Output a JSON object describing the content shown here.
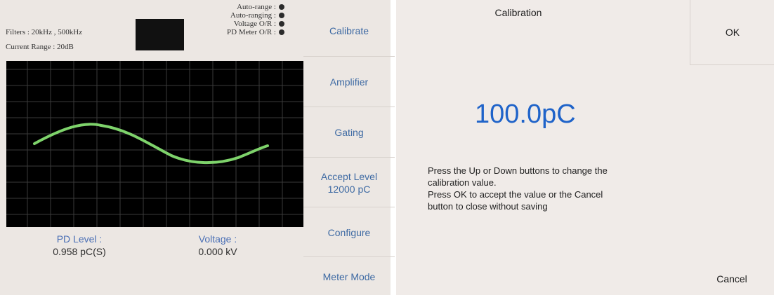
{
  "left": {
    "filters": "Filters : 20kHz , 500kHz",
    "current_range": "Current Range : 20dB",
    "status": [
      "Auto-range :",
      "Auto-ranging :",
      "Voltage O/R :",
      "PD Meter O/R :"
    ],
    "pd_level_label": "PD Level :",
    "pd_level_value": "0.958 pC(S)",
    "voltage_label": "Voltage :",
    "voltage_value": "0.000 kV",
    "buttons": [
      "Calibrate",
      "Amplifier",
      "Gating",
      "Accept Level 12000 pC",
      "Configure",
      "Meter Mode"
    ]
  },
  "right": {
    "title": "Calibration",
    "ok": "OK",
    "value": "100.0pC",
    "instructions": [
      "Press the Up or Down buttons to change the",
      "calibration value.",
      "Press OK to accept the value or the Cancel",
      "button to close without saving"
    ],
    "cancel": "Cancel"
  },
  "colors": {
    "accent_blue": "#1f63c9",
    "button_blue": "#3e6aa3",
    "trace_green": "#7ed36b"
  }
}
